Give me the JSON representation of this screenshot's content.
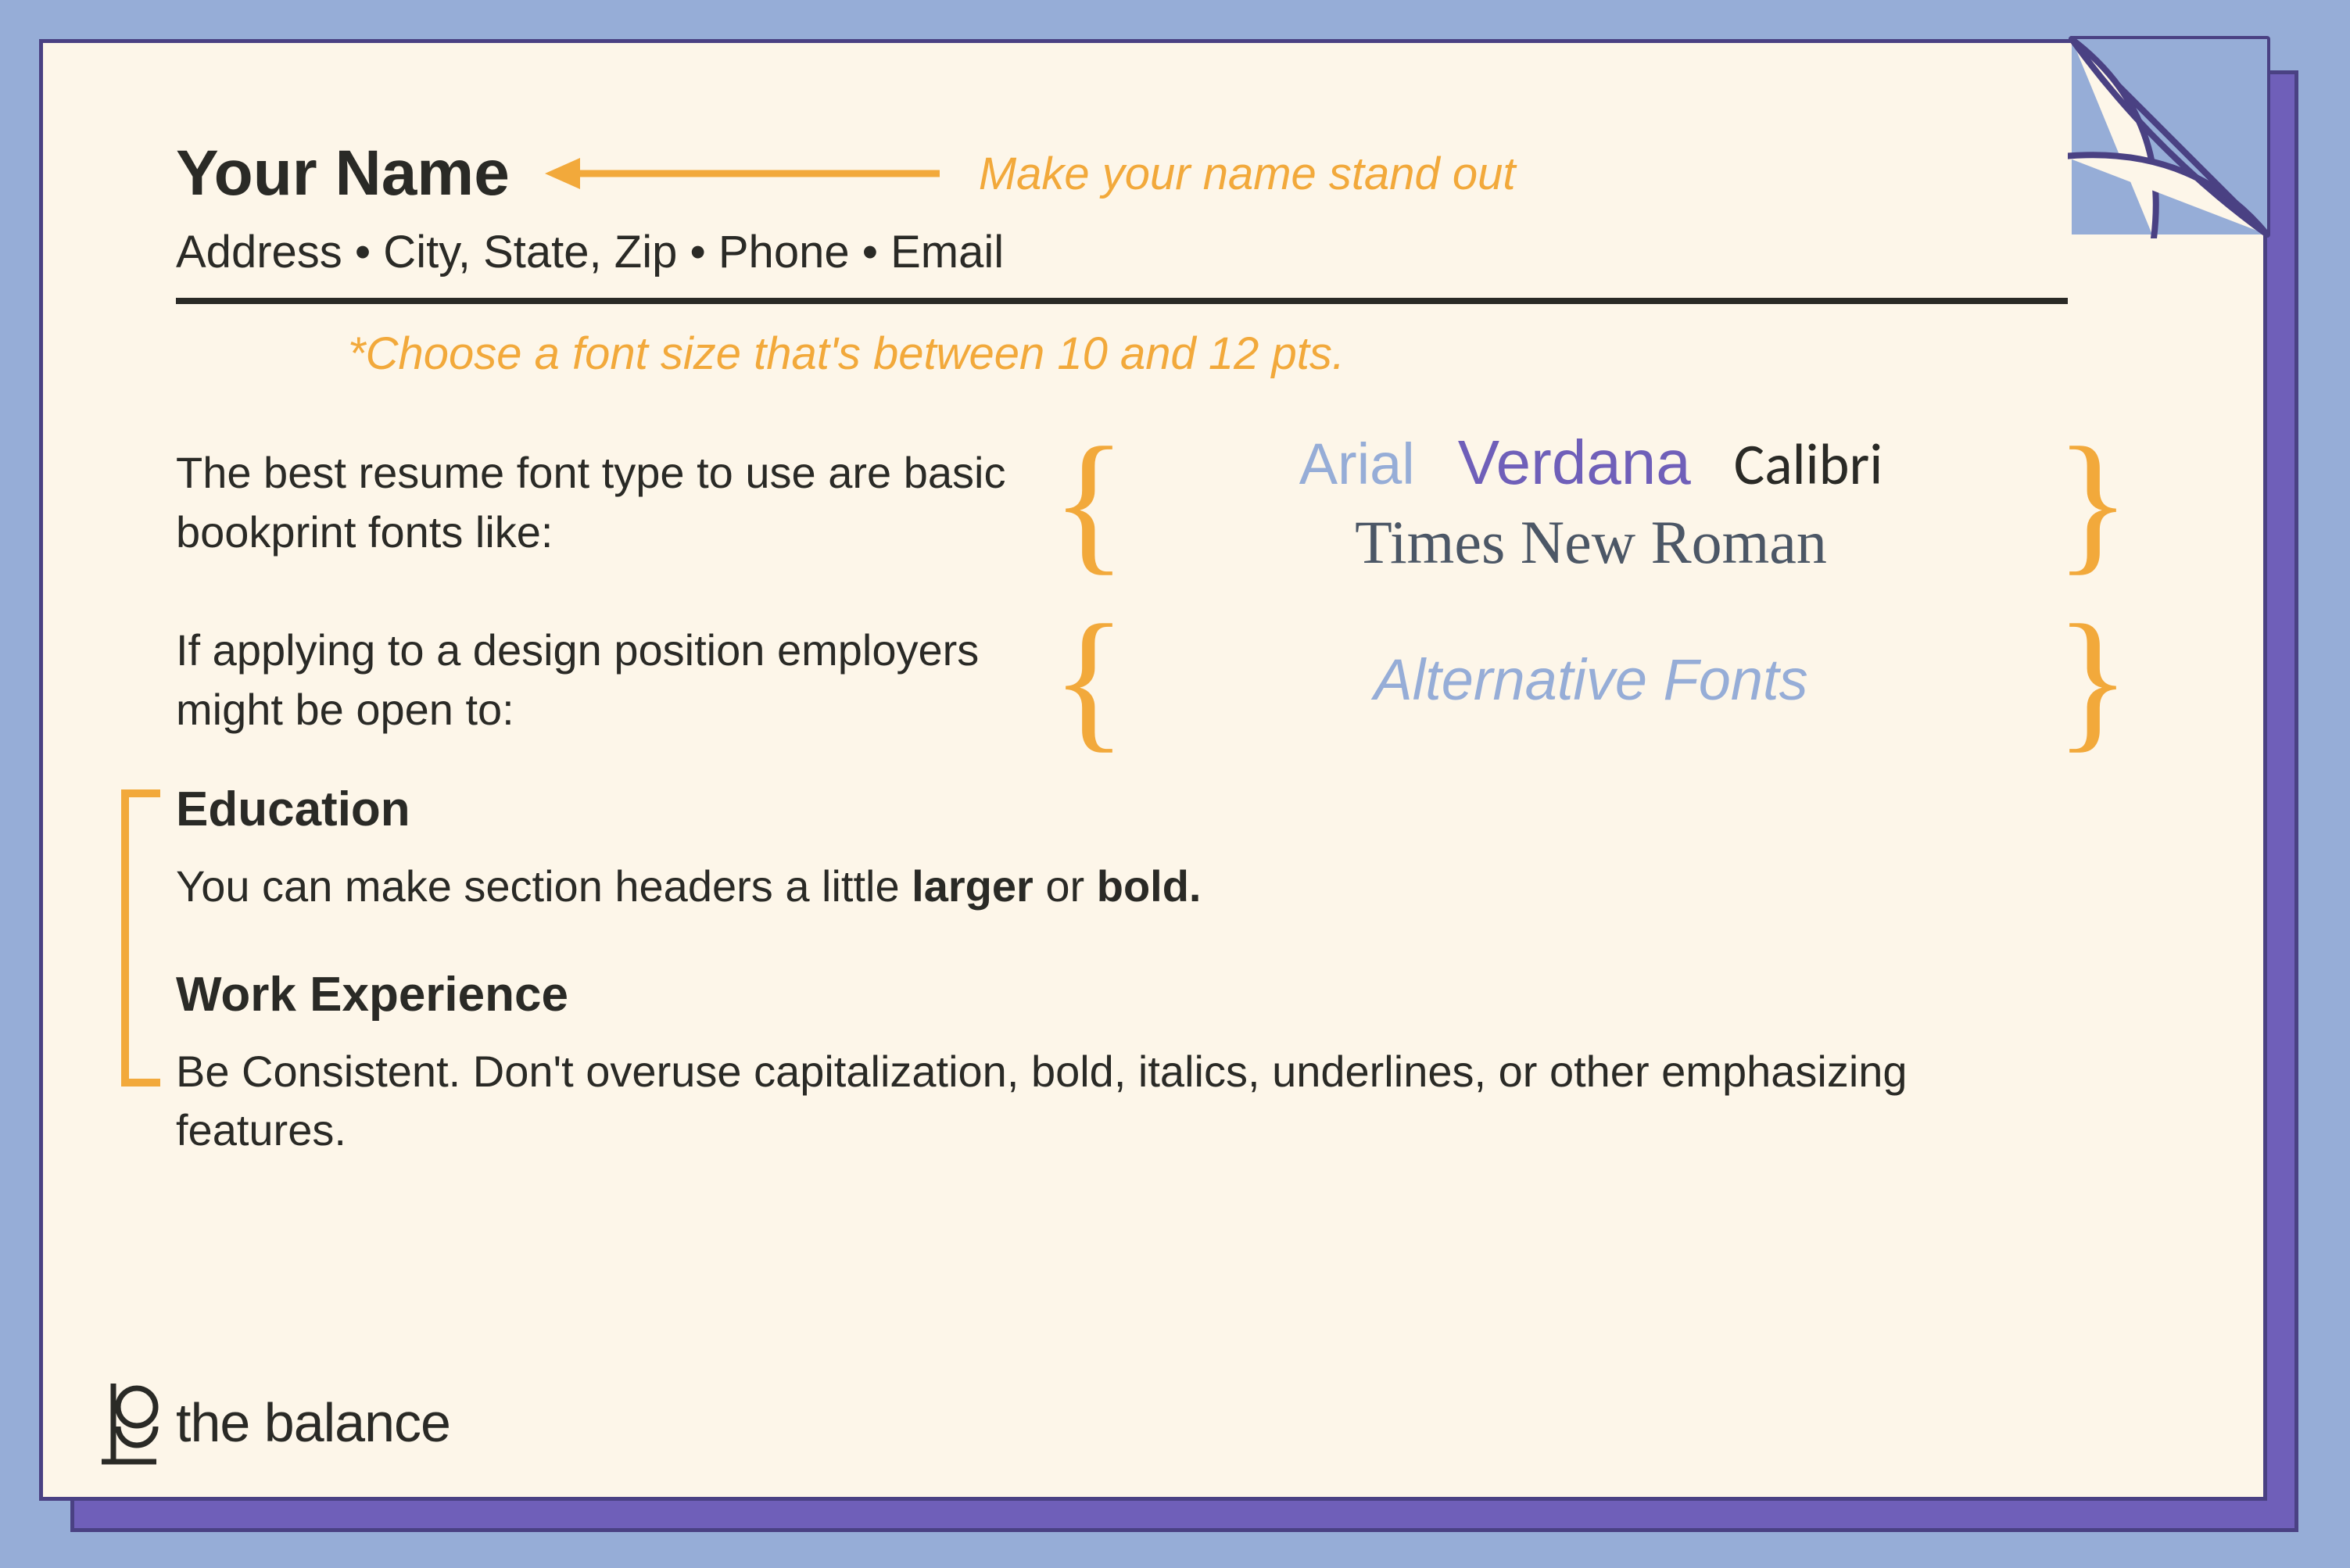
{
  "header": {
    "name": "Your Name",
    "callout": "Make your name stand out",
    "contact": "Address • City, State, Zip • Phone • Email"
  },
  "tip": "*Choose a font size that's between 10 and 12 pts.",
  "block1": {
    "text": "The best resume font type to use are basic bookprint fonts like:",
    "fonts": {
      "arial": "Arial",
      "verdana": "Verdana",
      "calibri": "Calibri",
      "tnr": "Times New Roman"
    }
  },
  "block2": {
    "text": "If applying to a design position employers might be open to:",
    "alt": "Alternative Fonts"
  },
  "education": {
    "head": "Education",
    "body_pre": "You can make section headers a little ",
    "body_b1": "larger",
    "body_mid": " or ",
    "body_b2": "bold."
  },
  "work": {
    "head": "Work Experience",
    "body": "Be Consistent. Don't overuse capitalization, bold, italics, underlines, or other emphasizing features."
  },
  "brand": "the balance"
}
